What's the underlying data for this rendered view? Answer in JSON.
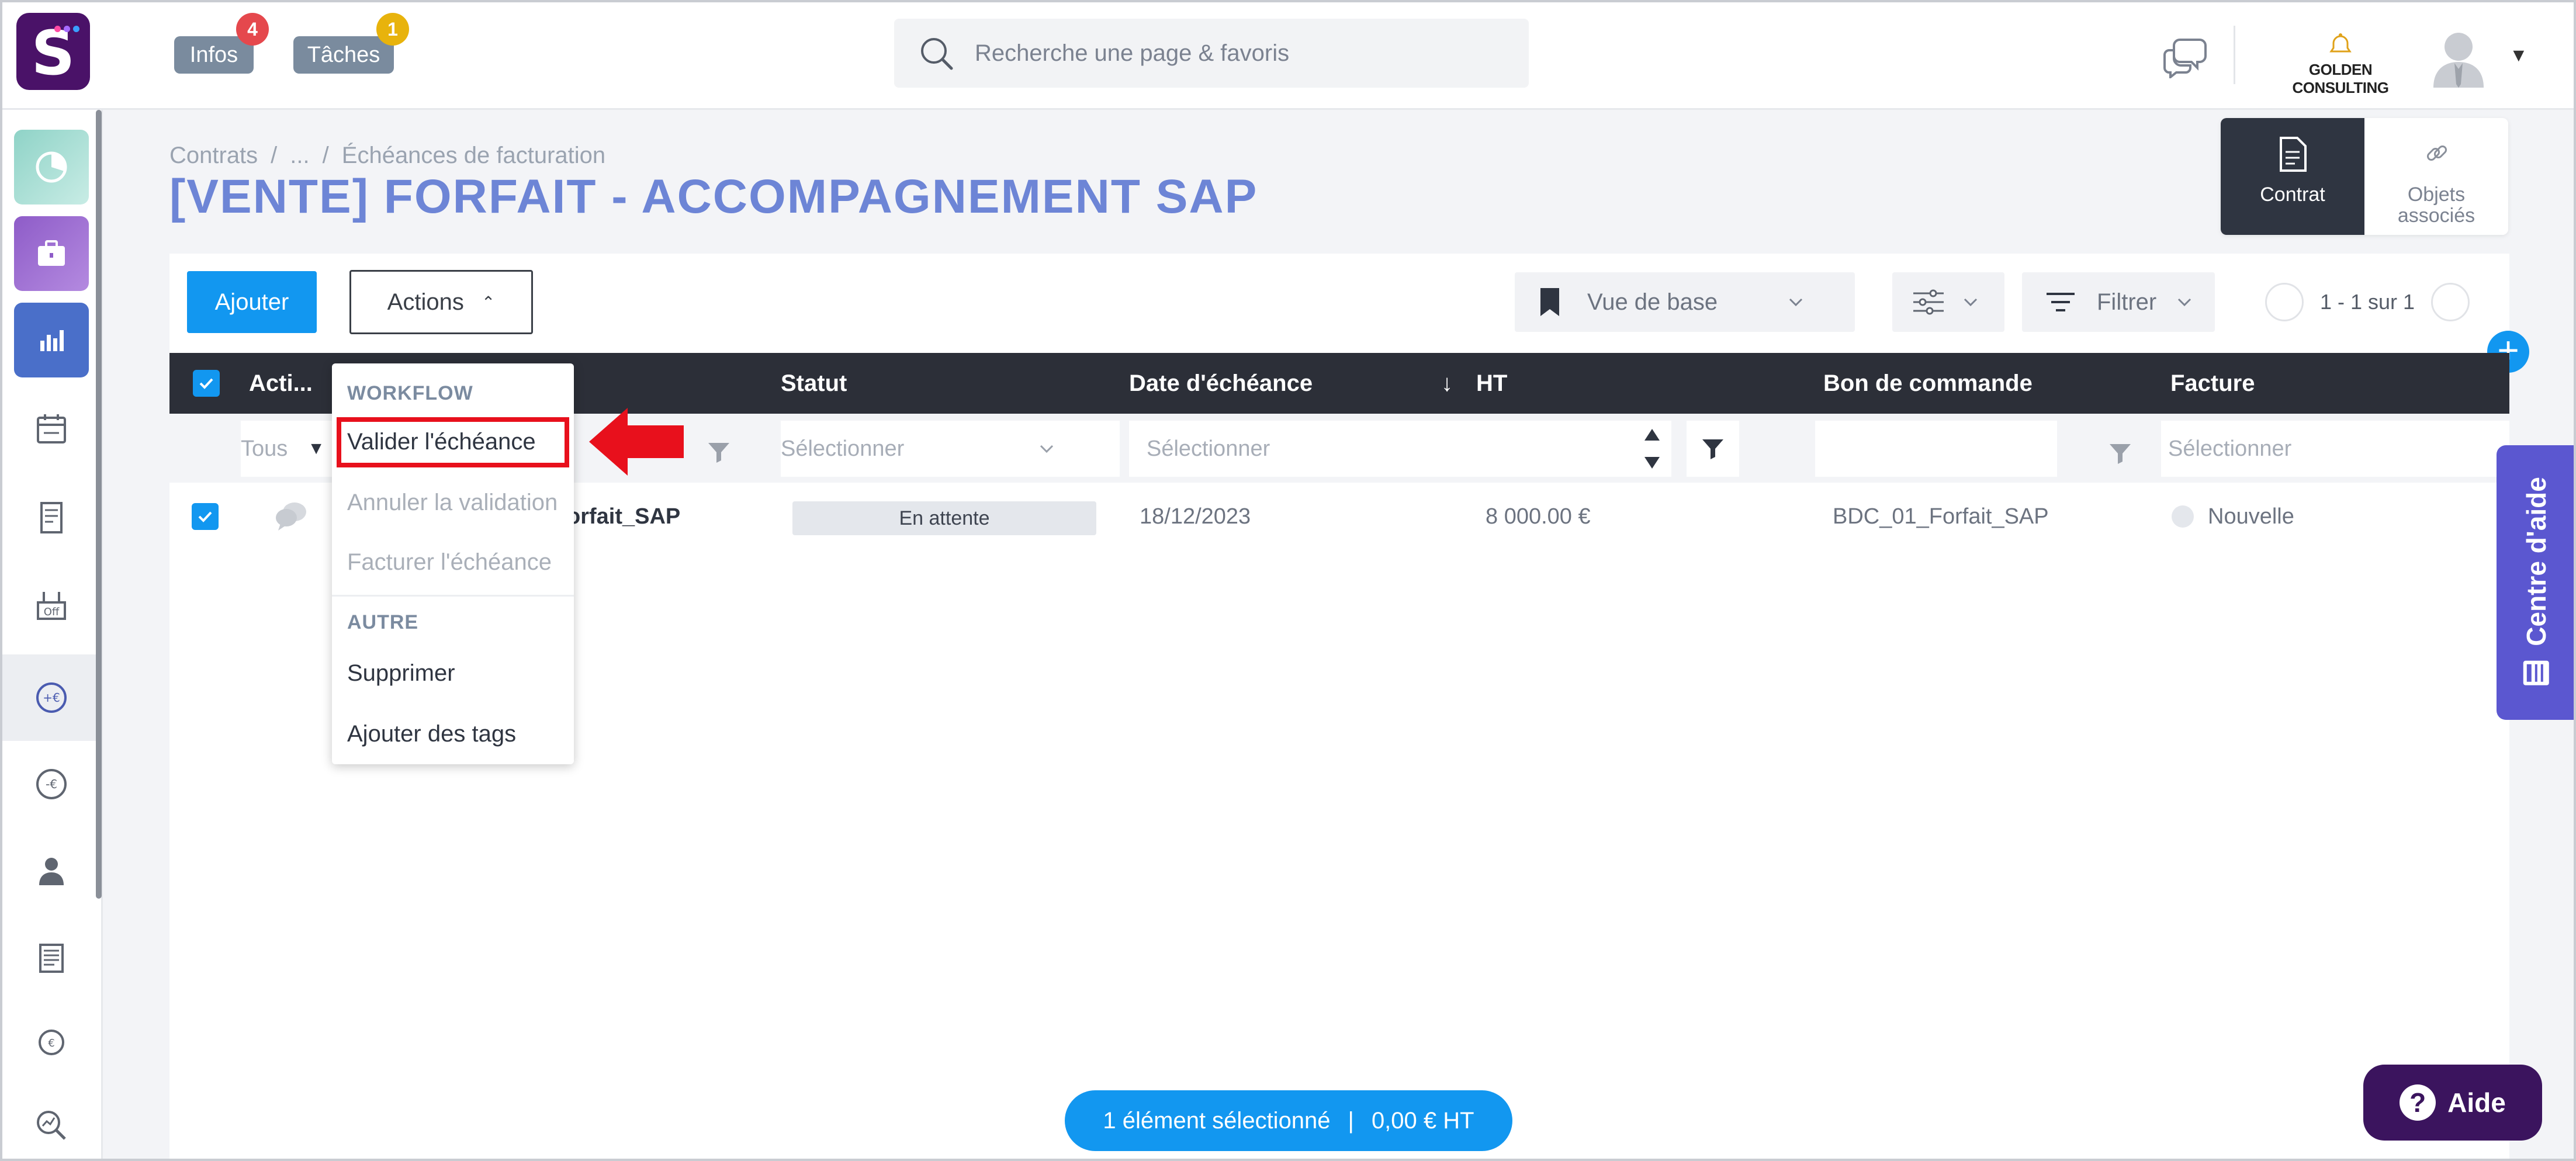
{
  "header": {
    "infos_label": "Infos",
    "infos_count": "4",
    "taches_label": "Tâches",
    "taches_count": "1",
    "search_placeholder": "Recherche une page & favoris",
    "company_name": "GOLDEN CONSULTING"
  },
  "breadcrumb": [
    "Contrats",
    "/",
    "...",
    "/",
    "Échéances de facturation"
  ],
  "page_title": "[VENTE] FORFAIT - ACCOMPAGNEMENT SAP",
  "tabs": [
    {
      "label": "Contrat",
      "active": true
    },
    {
      "label": "Objets\nassociés",
      "active": false
    }
  ],
  "toolbar": {
    "add_label": "Ajouter",
    "actions_label": "Actions",
    "view_label": "Vue de base",
    "filter_label": "Filtrer",
    "pager_text": "1 - 1 sur 1"
  },
  "table": {
    "columns": [
      "Acti...",
      "Statut",
      "Date d'échéance",
      "HT",
      "Bon de commande",
      "Facture"
    ],
    "sort_indicator": "↓",
    "filters": {
      "actions": "Tous",
      "statut": "Sélectionner",
      "date": "Sélectionner",
      "facture": "Sélectionner"
    },
    "rows": [
      {
        "name": "orfait_SAP",
        "statut": "En attente",
        "date": "18/12/2023",
        "ht": "8 000.00 €",
        "bon_de_commande": "BDC_01_Forfait_SAP",
        "facture": "Nouvelle"
      }
    ]
  },
  "menu": {
    "section_workflow": "WORKFLOW",
    "validate": "Valider l'échéance",
    "cancel_validation": "Annuler la validation",
    "invoice": "Facturer l'échéance",
    "section_other": "AUTRE",
    "delete": "Supprimer",
    "add_tags": "Ajouter des tags"
  },
  "selection_bar": {
    "count_text": "1 élément sélectionné",
    "separator": "|",
    "amount_text": "0,00 € HT"
  },
  "help": {
    "side_tab": "Centre d'aide",
    "button": "Aide",
    "button_glyph": "?"
  },
  "colors": {
    "accent": "#1297f0",
    "title": "#6d85d6",
    "header_row": "#2c2f38",
    "highlight": "#e8101c",
    "help_tab": "#5b57d0",
    "aide_button": "#3b145e"
  }
}
